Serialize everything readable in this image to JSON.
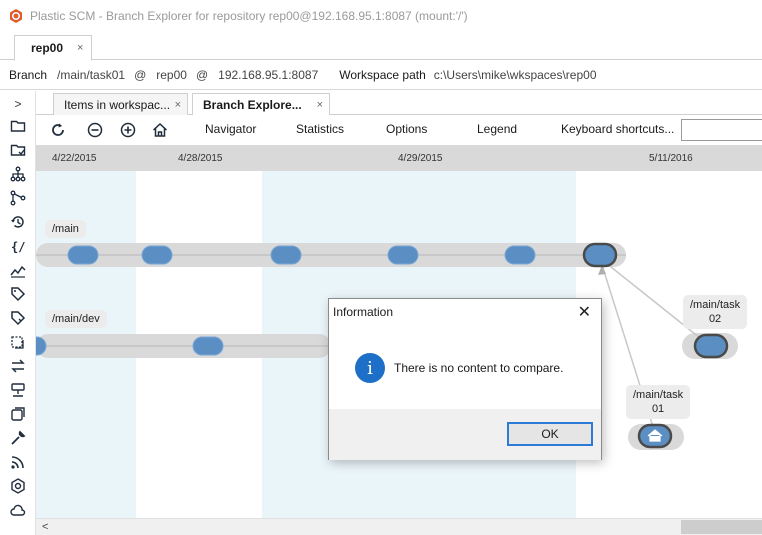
{
  "window": {
    "title": "Plastic SCM - Branch Explorer for repository rep00@192.168.95.1:8087 (mount:'/')"
  },
  "repo_tab": {
    "label": "rep00",
    "close": "×"
  },
  "infobar": {
    "branch_label": "Branch",
    "branch_value": "/main/task01",
    "at1": "@",
    "repo_value": "rep00",
    "at2": "@",
    "server_value": "192.168.95.1:8087",
    "workspace_label": "Workspace path",
    "workspace_value": "c:\\Users\\mike\\wkspaces\\rep00"
  },
  "leftbar": {
    "expand": ">",
    "icons": [
      "folder-icon",
      "pending-changes-icon",
      "branches-icon",
      "branch-merge-icon",
      "history-icon",
      "code-review-icon",
      "chart-icon",
      "label-icon",
      "tag-icon",
      "shelves-icon",
      "sync-icon",
      "server-icon",
      "workspaces-icon",
      "tools-icon",
      "feed-icon",
      "plastic-icon",
      "cloud-icon"
    ]
  },
  "doc_tabs": [
    {
      "label": "Items in workspac...",
      "close": "×"
    },
    {
      "label": "Branch Explore...",
      "close": "×"
    }
  ],
  "toolbar": {
    "links": [
      "Navigator",
      "Statistics",
      "Options",
      "Legend",
      "Keyboard shortcuts..."
    ],
    "search_placeholder": ""
  },
  "explorer": {
    "dates": [
      "4/22/2015",
      "4/28/2015",
      "4/29/2015",
      "5/11/2016"
    ],
    "branches": [
      {
        "name": "/main"
      },
      {
        "name": "/main/dev"
      },
      {
        "name": "/main/task\n02"
      },
      {
        "name": "/main/task\n01"
      }
    ],
    "colors": {
      "changeset": "#5b8fc4",
      "branch_bar": "#d9d9d9",
      "column_highlight": "#eaf5fa",
      "date_bar": "#d9d9d9"
    }
  },
  "hscroll": {
    "left_arrow": "<"
  },
  "dialog": {
    "title": "Information",
    "close": "✕",
    "icon_glyph": "i",
    "message": "There is no content to compare.",
    "ok_label": "OK"
  }
}
